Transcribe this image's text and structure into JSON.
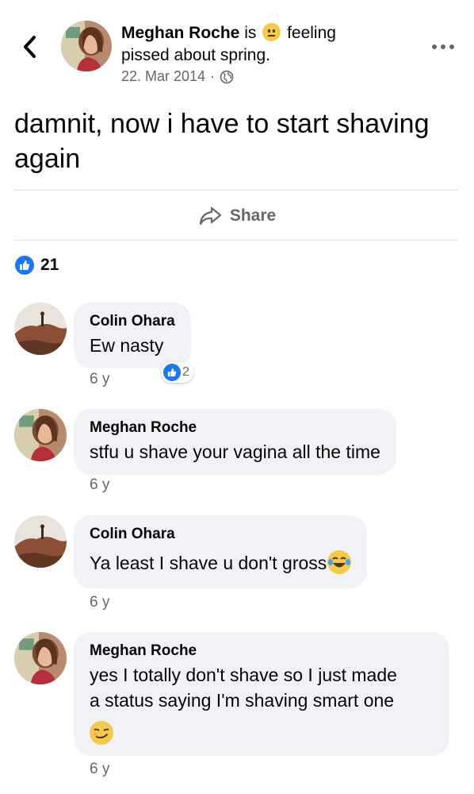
{
  "post": {
    "author": "Meghan Roche",
    "is_text": "is",
    "feeling_text": "feeling",
    "feeling_line2": "pissed about spring.",
    "date": "22. Mar 2014",
    "separator": "·",
    "body_line1": "damnit, now i have to start shaving",
    "body_line2": "again",
    "share_label": "Share",
    "reaction_count": "21"
  },
  "comments": [
    {
      "name": "Colin Ohara",
      "text": "Ew nasty",
      "time": "6 y",
      "reaction_count": "2"
    },
    {
      "name": "Meghan Roche",
      "text": "stfu u shave your vagina all the time",
      "time": "6 y"
    },
    {
      "name": "Colin Ohara",
      "text": "Ya least I shave u don't gross",
      "time": "6 y"
    },
    {
      "name": "Meghan Roche",
      "text_line1": "yes I totally don't shave so I just made",
      "text_line2": "a status saying I'm shaving smart one",
      "time": "6 y"
    }
  ],
  "icons": {
    "back": "chevron-left-icon",
    "more": "more-options-icon",
    "privacy": "globe-icon",
    "share": "share-arrow-icon",
    "like": "like-thumb-icon",
    "feeling": "neutral-face-emoji",
    "laugh": "tears-of-joy-emoji",
    "smirk": "smirking-face-emoji"
  },
  "colors": {
    "accent": "#1877f2",
    "bubble": "#f0f2f5",
    "muted": "#65676b",
    "divider": "#dadde1"
  }
}
